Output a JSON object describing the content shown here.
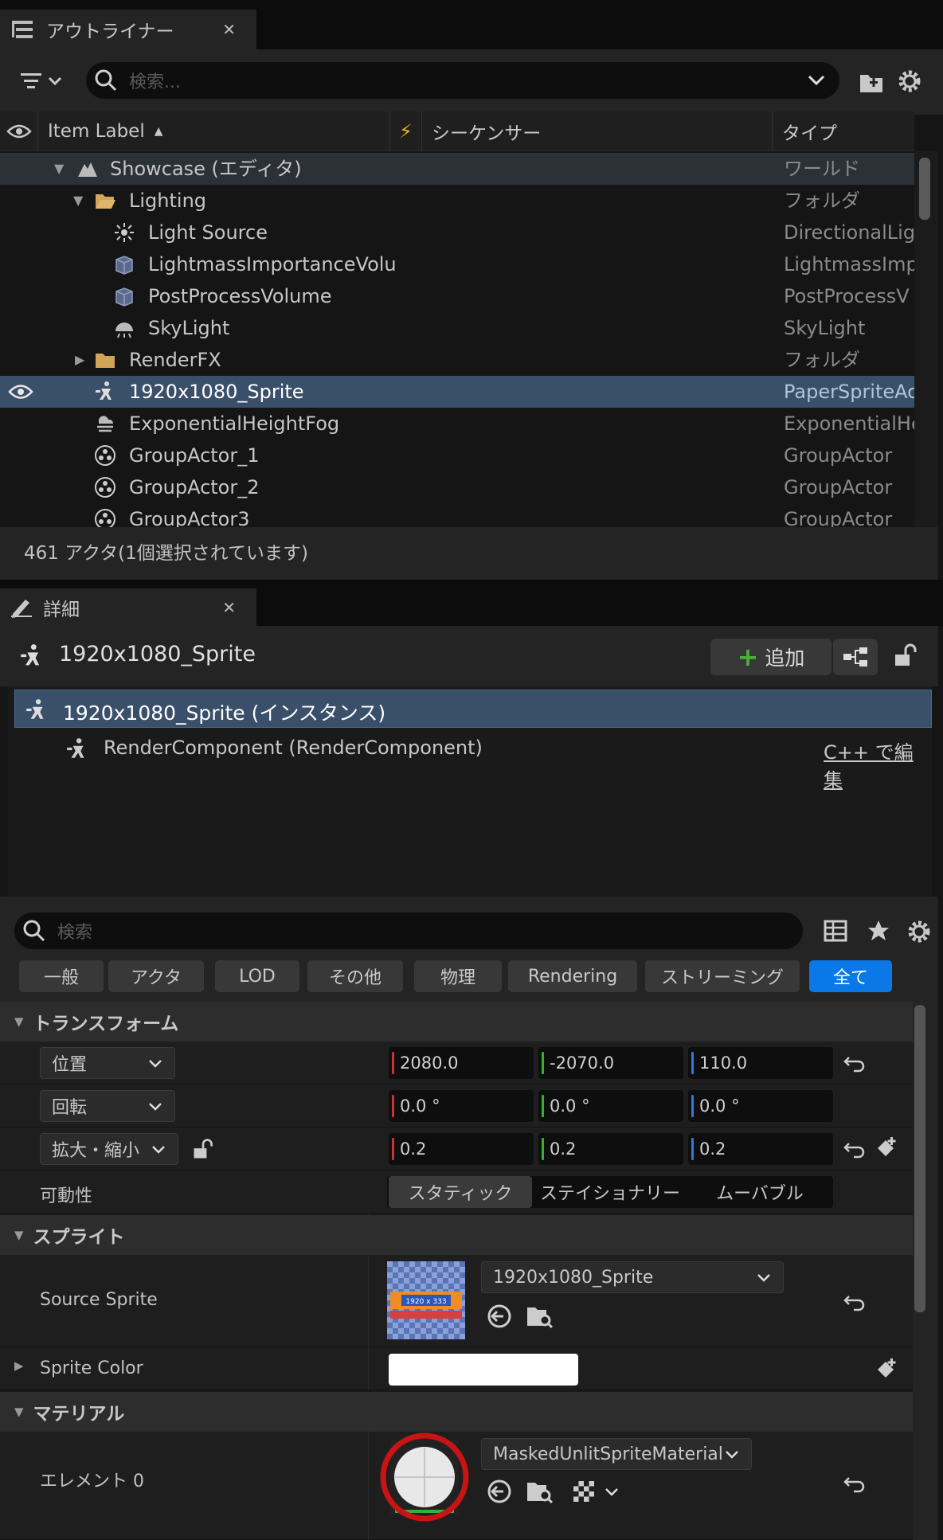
{
  "outliner": {
    "tab_title": "アウトライナー",
    "search_placeholder": "検索...",
    "columns": {
      "label": "Item Label",
      "sequencer": "シーケンサー",
      "type": "タイプ"
    },
    "rows": [
      {
        "label": "Showcase (エディタ)",
        "type": "ワールド",
        "icon": "world-icon"
      },
      {
        "label": "Lighting",
        "type": "フォルダ",
        "icon": "folder-open-icon"
      },
      {
        "label": "Light Source",
        "type": "DirectionalLig",
        "icon": "directional-light-icon"
      },
      {
        "label": "LightmassImportanceVolu",
        "type": "LightmassImp",
        "icon": "volume-icon"
      },
      {
        "label": "PostProcessVolume",
        "type": "PostProcessV",
        "icon": "volume-icon"
      },
      {
        "label": "SkyLight",
        "type": "SkyLight",
        "icon": "skylight-icon"
      },
      {
        "label": "RenderFX",
        "type": "フォルダ",
        "icon": "folder-icon"
      },
      {
        "label": "1920x1080_Sprite",
        "type": "PaperSpriteAc",
        "icon": "sprite-actor-icon"
      },
      {
        "label": "ExponentialHeightFog",
        "type": "ExponentialHe",
        "icon": "fog-icon"
      },
      {
        "label": "GroupActor_1",
        "type": "GroupActor",
        "icon": "group-actor-icon"
      },
      {
        "label": "GroupActor_2",
        "type": "GroupActor",
        "icon": "group-actor-icon"
      },
      {
        "label": "GroupActor3",
        "type": "GroupActor",
        "icon": "group-actor-icon"
      }
    ],
    "status": "461 アクタ(1個選択されています)"
  },
  "details": {
    "tab_title": "詳細",
    "actor_name": "1920x1080_Sprite",
    "add_label": "追加",
    "components": [
      {
        "label": "1920x1080_Sprite (インスタンス)"
      },
      {
        "label": "RenderComponent (RenderComponent)"
      }
    ],
    "edit_cpp": "C++ で編集",
    "search_placeholder": "検索",
    "categories": [
      "一般",
      "アクタ",
      "LOD",
      "その他",
      "物理",
      "Rendering",
      "ストリーミング",
      "全て"
    ],
    "transform": {
      "section": "トランスフォーム",
      "location_label": "位置",
      "rotation_label": "回転",
      "scale_label": "拡大・縮小",
      "mobility_label": "可動性",
      "location": [
        "2080.0",
        "-2070.0",
        "110.0"
      ],
      "rotation": [
        "0.0 °",
        "0.0 °",
        "0.0 °"
      ],
      "scale": [
        "0.2",
        "0.2",
        "0.2"
      ],
      "mobility_options": [
        "スタティック",
        "ステイショナリー",
        "ムーバブル"
      ],
      "mobility_selected": "スタティック"
    },
    "sprite": {
      "section": "スプライト",
      "source_label": "Source Sprite",
      "source_value": "1920x1080_Sprite",
      "color_label": "Sprite Color",
      "thumb_text": "1920 x 333"
    },
    "material": {
      "section": "マテリアル",
      "element_label": "エレメント 0",
      "value": "MaskedUnlitSpriteMaterial"
    }
  },
  "colors": {
    "selection": "#3a4f69",
    "accent": "#0a78e6",
    "x_axis": "#c83232",
    "y_axis": "#32b432",
    "z_axis": "#3278dc",
    "annotation_circle": "#c81414"
  }
}
